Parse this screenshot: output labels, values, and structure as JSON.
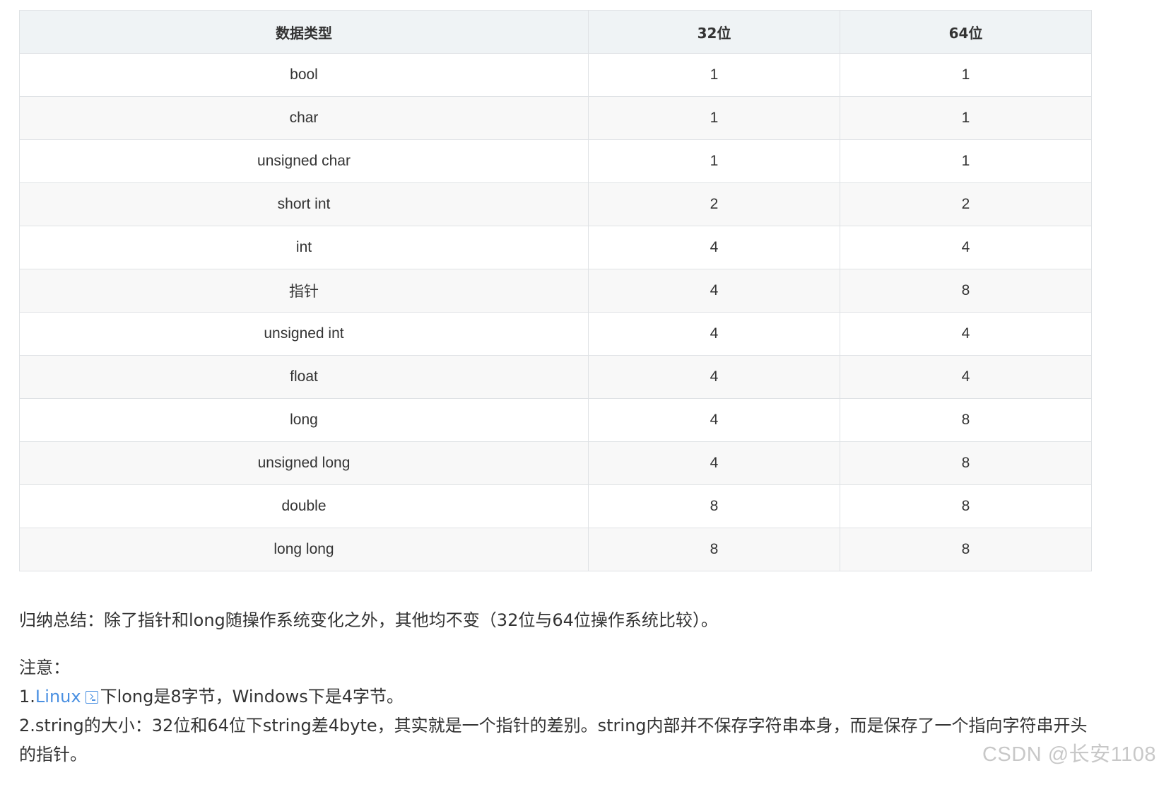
{
  "table": {
    "headers": [
      "数据类型",
      "32位",
      "64位"
    ],
    "rows": [
      [
        "bool",
        "1",
        "1"
      ],
      [
        "char",
        "1",
        "1"
      ],
      [
        "unsigned char",
        "1",
        "1"
      ],
      [
        "short int",
        "2",
        "2"
      ],
      [
        "int",
        "4",
        "4"
      ],
      [
        "指针",
        "4",
        "8"
      ],
      [
        "unsigned int",
        "4",
        "4"
      ],
      [
        "float",
        "4",
        "4"
      ],
      [
        "long",
        "4",
        "8"
      ],
      [
        "unsigned long",
        "4",
        "8"
      ],
      [
        "double",
        "8",
        "8"
      ],
      [
        "long long",
        "8",
        "8"
      ]
    ]
  },
  "summary": "归纳总结：除了指针和long随操作系统变化之外，其他均不变（32位与64位操作系统比较）。",
  "notes": {
    "title": "注意：",
    "item1_prefix": "1.",
    "item1_link": "Linux",
    "item1_icon": "terminal-icon",
    "item1_rest": "下long是8字节，Windows下是4字节。",
    "item2": "2.string的大小：32位和64位下string差4byte，其实就是一个指针的差别。string内部并不保存字符串本身，而是保存了一个指向字符串开头的指针。"
  },
  "watermark": "CSDN @长安1108",
  "colors": {
    "link": "#4a90e2",
    "header_bg": "#eff3f5",
    "border": "#dfe2e5",
    "stripe": "#f8f8f8"
  }
}
